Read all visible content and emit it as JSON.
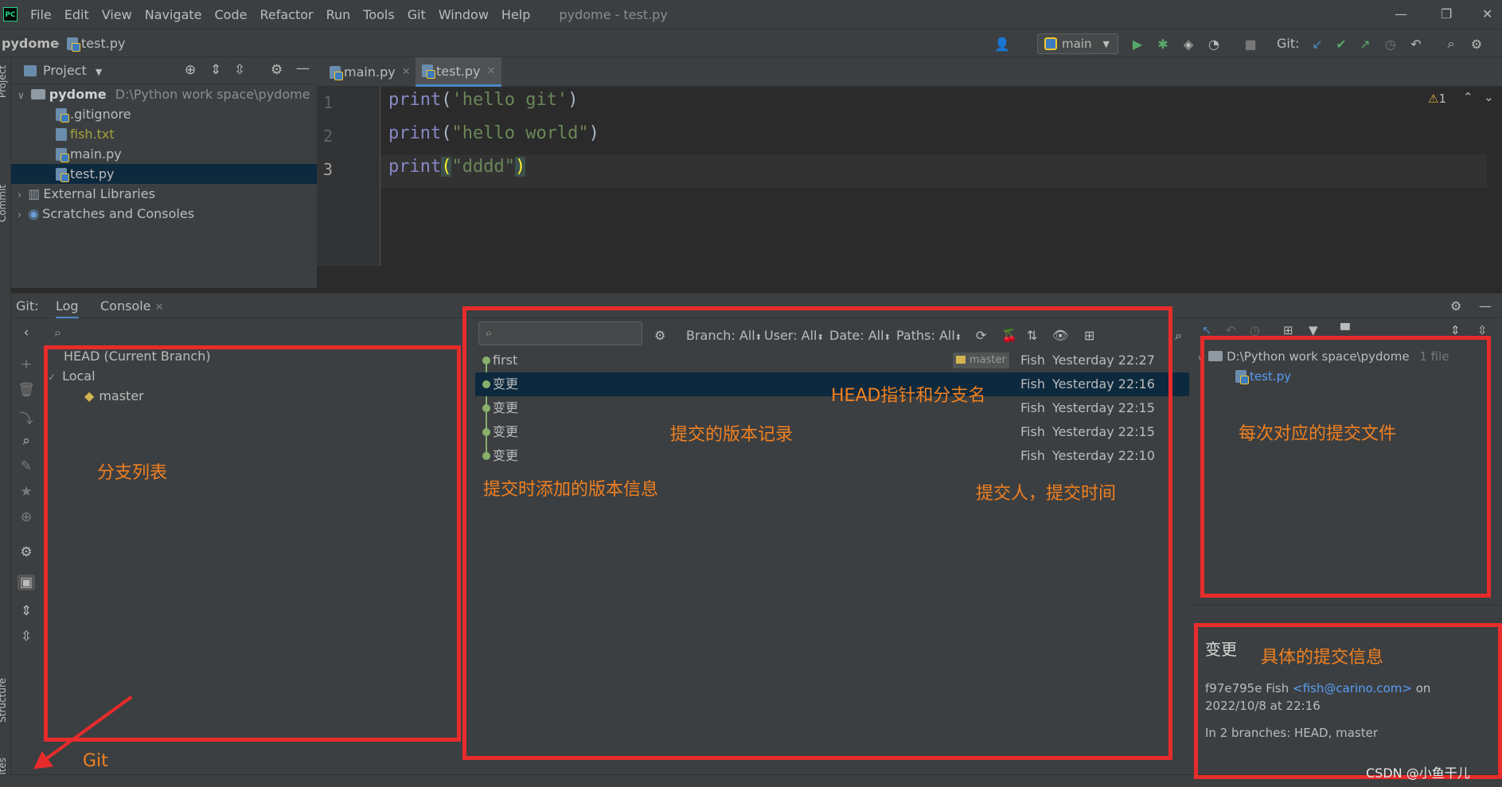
{
  "menu": {
    "items": [
      "File",
      "Edit",
      "View",
      "Navigate",
      "Code",
      "Refactor",
      "Run",
      "Tools",
      "Git",
      "Window",
      "Help"
    ],
    "title": "pydome - test.py",
    "logo_text": "PC"
  },
  "navbar": {
    "project": "pydome",
    "file": "test.py",
    "run_config": "main",
    "git_label": "Git:"
  },
  "project_panel": {
    "title": "Project",
    "root_name": "pydome",
    "root_path": "D:\\Python work space\\pydome",
    "files": [
      ".gitignore",
      "fish.txt",
      "main.py",
      "test.py"
    ],
    "external": "External Libraries",
    "scratches": "Scratches and Consoles"
  },
  "editor": {
    "tabs": [
      {
        "label": "main.py"
      },
      {
        "label": "test.py"
      }
    ],
    "line_numbers": [
      "1",
      "2",
      "3"
    ],
    "lines": [
      {
        "fn": "print",
        "open": "(",
        "str": "'hello git'",
        "close": ")"
      },
      {
        "fn": "print",
        "open": "(",
        "str": "\"hello world\"",
        "close": ")"
      },
      {
        "fn": "print",
        "open": "(",
        "str": "\"dddd\"",
        "close": ")"
      }
    ],
    "warning_count": "1"
  },
  "git": {
    "prefix": "Git:",
    "tabs": [
      "Log",
      "Console"
    ],
    "branches": {
      "head": "HEAD (Current Branch)",
      "local": "Local",
      "master": "master"
    },
    "filters": {
      "branch": "Branch: All",
      "user": "User: All",
      "date": "Date: All",
      "paths": "Paths: All"
    },
    "commits": [
      {
        "msg": "first",
        "author": "Fish",
        "date": "Yesterday 22:27",
        "tag": "master"
      },
      {
        "msg": "变更",
        "author": "Fish",
        "date": "Yesterday 22:16",
        "tag": ""
      },
      {
        "msg": "变更",
        "author": "Fish",
        "date": "Yesterday 22:15",
        "tag": ""
      },
      {
        "msg": "变更",
        "author": "Fish",
        "date": "Yesterday 22:15",
        "tag": ""
      },
      {
        "msg": "变更",
        "author": "Fish",
        "date": "Yesterday 22:10",
        "tag": ""
      }
    ],
    "changed": {
      "path": "D:\\Python work space\\pydome",
      "count": "1 file",
      "file": "test.py"
    },
    "details": {
      "title": "变更",
      "hash_author": "f97e795e Fish",
      "email": "<fish@carino.com>",
      "on": "on",
      "datetime": "2022/10/8 at 22:16",
      "branches": "In 2 branches: HEAD, master"
    }
  },
  "annotations": {
    "branch_list": "分支列表",
    "head_pointer": "HEAD指针和分支名",
    "commit_records": "提交的版本记录",
    "commit_message": "提交时添加的版本信息",
    "author_time": "提交人，提交时间",
    "commit_files": "每次对应的提交文件",
    "commit_details": "具体的提交信息",
    "git": "Git"
  },
  "sidebar_labels": {
    "project": "Project",
    "commit": "Commit",
    "structure": "Structure",
    "favorites": "Favorites"
  },
  "watermark": "CSDN @小鱼干儿",
  "colors": {
    "accent": "#4a88c7",
    "annotation_red": "#e82b2b",
    "annotation_orange": "#f08020",
    "graph_green": "#88b06b",
    "selection": "#0d293e"
  }
}
